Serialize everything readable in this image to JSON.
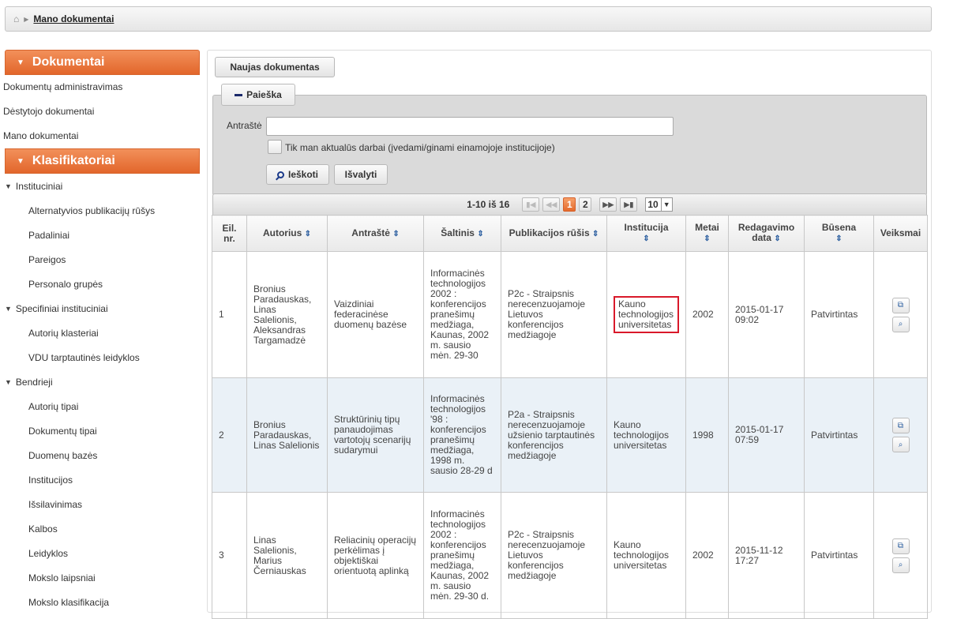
{
  "breadcrumb": {
    "current": "Mano dokumentai"
  },
  "sidebar": {
    "dokumentai_title": "Dokumentai",
    "dokumentai_links": [
      "Dokumentų administravimas",
      "Dėstytojo dokumentai",
      "Mano dokumentai"
    ],
    "klasifikatoriai_title": "Klasifikatoriai",
    "groups": [
      {
        "label": "Instituciniai",
        "items": [
          "Alternatyvios publikacijų rūšys",
          "Padaliniai",
          "Pareigos",
          "Personalo grupės"
        ]
      },
      {
        "label": "Specifiniai instituciniai",
        "items": [
          "Autorių klasteriai",
          "VDU tarptautinės leidyklos"
        ]
      },
      {
        "label": "Bendrieji",
        "items": [
          "Autorių tipai",
          "Dokumentų tipai",
          "Duomenų bazės",
          "Institucijos",
          "Išsilavinimas",
          "Kalbos",
          "Leidyklos",
          "Mokslo laipsniai",
          "Mokslo klasifikacija"
        ]
      }
    ]
  },
  "toolbar": {
    "new_label": "Naujas dokumentas"
  },
  "search": {
    "legend": "Paieška",
    "title_label": "Antraštė",
    "title_value": "",
    "checkbox_label": "Tik man aktualūs darbai (įvedami/ginami einamojoje institucijoje)",
    "search_label": "Ieškoti",
    "clear_label": "Išvalyti"
  },
  "pager": {
    "count": "1-10 iš 16",
    "pages": [
      "1",
      "2"
    ],
    "current_page": "1",
    "rows": "10"
  },
  "table": {
    "headers": {
      "nr": "Eil. nr.",
      "autorius": "Autorius",
      "antraste": "Antraštė",
      "saltinis": "Šaltinis",
      "rusis": "Publikacijos rūšis",
      "institucija": "Institucija",
      "metai": "Metai",
      "redagavimo": "Redagavimo data",
      "busena": "Būsena",
      "veiksmai": "Veiksmai"
    },
    "rows": [
      {
        "nr": "1",
        "autorius": "Bronius Paradauskas, Linas Salelionis, Aleksandras Targamadzė",
        "antraste": "Vaizdiniai federacinėse duomenų bazėse",
        "saltinis": "Informacinės technologijos 2002 : konferencijos pranešimų medžiaga, Kaunas, 2002 m. sausio mėn. 29-30",
        "rusis": "P2c - Straipsnis nerecenzuojamoje Lietuvos konferencijos medžiagoje",
        "institucija": "Kauno technologijos universitetas",
        "metai": "2002",
        "redagavimo": "2015-01-17 09:02",
        "busena": "Patvirtintas"
      },
      {
        "nr": "2",
        "autorius": "Bronius Paradauskas, Linas Salelionis",
        "antraste": "Struktūrinių tipų panaudojimas vartotojų scenarijų sudarymui",
        "saltinis": "Informacinės technologijos '98 : konferencijos pranešimų medžiaga, 1998 m. sausio 28-29 d",
        "rusis": "P2a - Straipsnis nerecenzuojamoje užsienio tarptautinės konferencijos medžiagoje",
        "institucija": "Kauno technologijos universitetas",
        "metai": "1998",
        "redagavimo": "2015-01-17 07:59",
        "busena": "Patvirtintas"
      },
      {
        "nr": "3",
        "autorius": "Linas Salelionis, Marius Černiauskas",
        "antraste": "Reliacinių operacijų perkėlimas į objektiškai orientuotą aplinką",
        "saltinis": "Informacinės technologijos 2002 : konferencijos pranešimų medžiaga, Kaunas, 2002 m. sausio mėn. 29-30 d.",
        "rusis": "P2c - Straipsnis nerecenzuojamoje Lietuvos konferencijos medžiagoje",
        "institucija": "Kauno technologijos universitetas",
        "metai": "2002",
        "redagavimo": "2015-11-12 17:27",
        "busena": "Patvirtintas"
      }
    ]
  }
}
